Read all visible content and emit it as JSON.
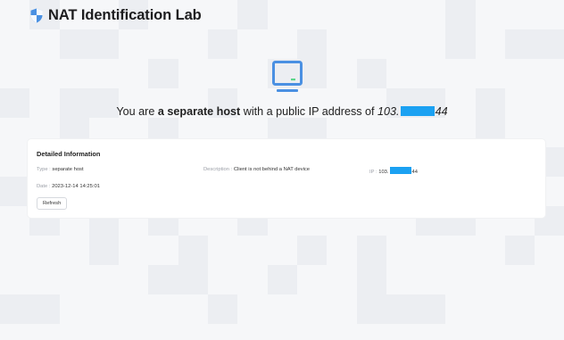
{
  "header": {
    "title": "NAT Identification Lab",
    "logo_icon": "shield-icon"
  },
  "colors": {
    "accent": "#4a90e2",
    "redaction": "#1ba1f2"
  },
  "headline": {
    "prefix": "You are ",
    "host_type": "a separate host",
    "middle": " with a public IP address of ",
    "ip_start": "103.",
    "ip_end": "44"
  },
  "details": {
    "title": "Detailed Information",
    "type_label": "Type :",
    "type_value": "separate host",
    "description_label": "Description :",
    "description_value": "Client is not behind a NAT device",
    "ip_label": "IP :",
    "ip_start": "103.",
    "ip_end": "44",
    "date_label": "Date :",
    "date_value": "2023-12-14 14:25:01",
    "refresh_label": "Refresh"
  }
}
